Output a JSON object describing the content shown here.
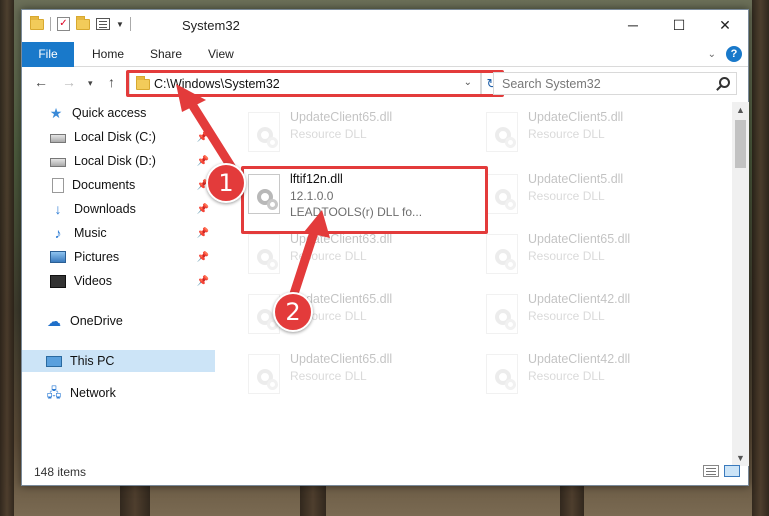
{
  "window": {
    "title": "System32",
    "controls": {
      "minimize": "─",
      "maximize": "☐",
      "close": "✕"
    }
  },
  "ribbon": {
    "tabs": [
      "File",
      "Home",
      "Share",
      "View"
    ],
    "help": "?"
  },
  "navbar": {
    "address": "C:\\Windows\\System32",
    "search_placeholder": "Search System32"
  },
  "sidebar": {
    "items": [
      {
        "label": "Quick access",
        "icon": "star-icon"
      },
      {
        "label": "Local Disk (C:)",
        "icon": "disk-icon",
        "pinned": true
      },
      {
        "label": "Local Disk (D:)",
        "icon": "disk-icon",
        "pinned": true
      },
      {
        "label": "Documents",
        "icon": "documents-icon",
        "pinned": true
      },
      {
        "label": "Downloads",
        "icon": "download-icon",
        "pinned": true
      },
      {
        "label": "Music",
        "icon": "music-icon",
        "pinned": true
      },
      {
        "label": "Pictures",
        "icon": "pictures-icon",
        "pinned": true
      },
      {
        "label": "Videos",
        "icon": "videos-icon",
        "pinned": true
      },
      {
        "label": "OneDrive",
        "icon": "cloud-icon"
      },
      {
        "label": "This PC",
        "icon": "computer-icon",
        "selected": true
      },
      {
        "label": "Network",
        "icon": "network-icon"
      }
    ]
  },
  "files": [
    {
      "name": "UpdateClient65.dll",
      "type": "Resource DLL"
    },
    {
      "name": "UpdateClient5.dll",
      "type": "Resource DLL"
    },
    {
      "name": "lftif12n.dll",
      "version": "12.1.0.0",
      "description": "LEADTOOLS(r) DLL fo..."
    },
    {
      "name": "UpdateClient5.dll",
      "type": "Resource DLL"
    },
    {
      "name": "UpdateClient63.dll",
      "type": "Resource DLL"
    },
    {
      "name": "UpdateClient65.dll",
      "type": "Resource DLL"
    },
    {
      "name": "UpdateClient65.dll",
      "type": "Resource DLL"
    },
    {
      "name": "UpdateClient42.dll",
      "type": "Resource DLL"
    },
    {
      "name": "UpdateClient65.dll",
      "type": "Resource DLL"
    },
    {
      "name": "UpdateClient42.dll",
      "type": "Resource DLL"
    }
  ],
  "status": {
    "item_count": "148 items"
  },
  "annotations": {
    "step1": "1",
    "step2": "2",
    "color": "#e33b3b"
  }
}
